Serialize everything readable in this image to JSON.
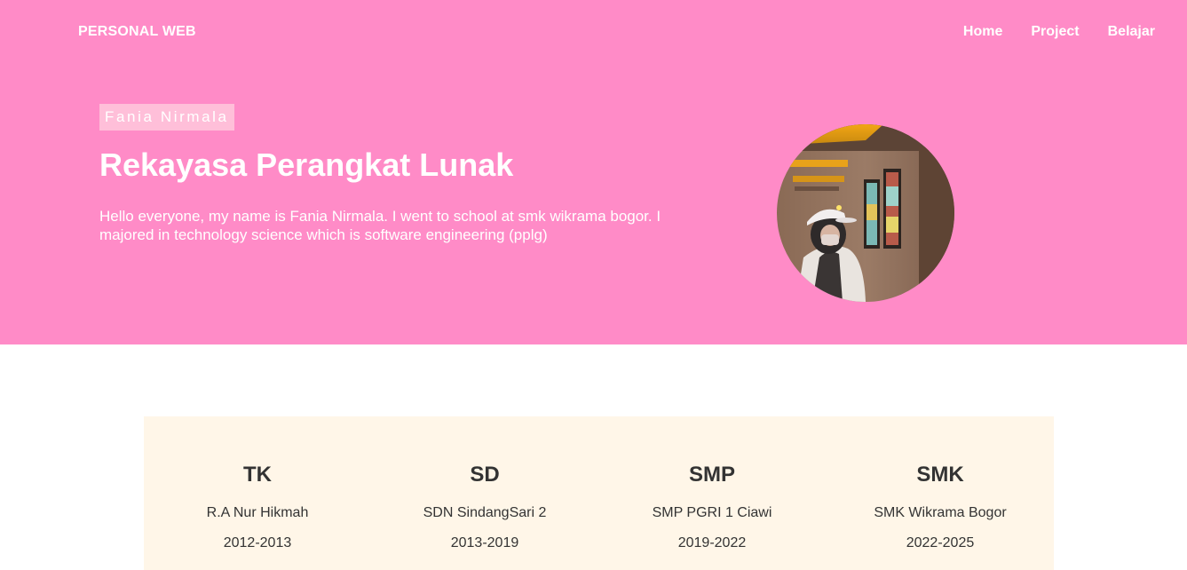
{
  "navbar": {
    "brand": "PERSONAL WEB",
    "links": [
      {
        "label": "Home"
      },
      {
        "label": "Project"
      },
      {
        "label": "Belajar"
      }
    ]
  },
  "hero": {
    "name_tag": "Fania Nirmala",
    "headline": "Rekayasa Perangkat Lunak",
    "intro": "Hello everyone, my name is Fania Nirmala. I went to school at smk wikrama bogor. I majored in technology science which is software engineering (pplg)",
    "background_color": "#ff8bc7"
  },
  "education": [
    {
      "level": "TK",
      "school": "R.A Nur Hikmah",
      "years": "2012-2013"
    },
    {
      "level": "SD",
      "school": "SDN SindangSari 2",
      "years": "2013-2019"
    },
    {
      "level": "SMP",
      "school": "SMP PGRI 1 Ciawi",
      "years": "2019-2022"
    },
    {
      "level": "SMK",
      "school": "SMK Wikrama Bogor",
      "years": "2022-2025"
    }
  ]
}
